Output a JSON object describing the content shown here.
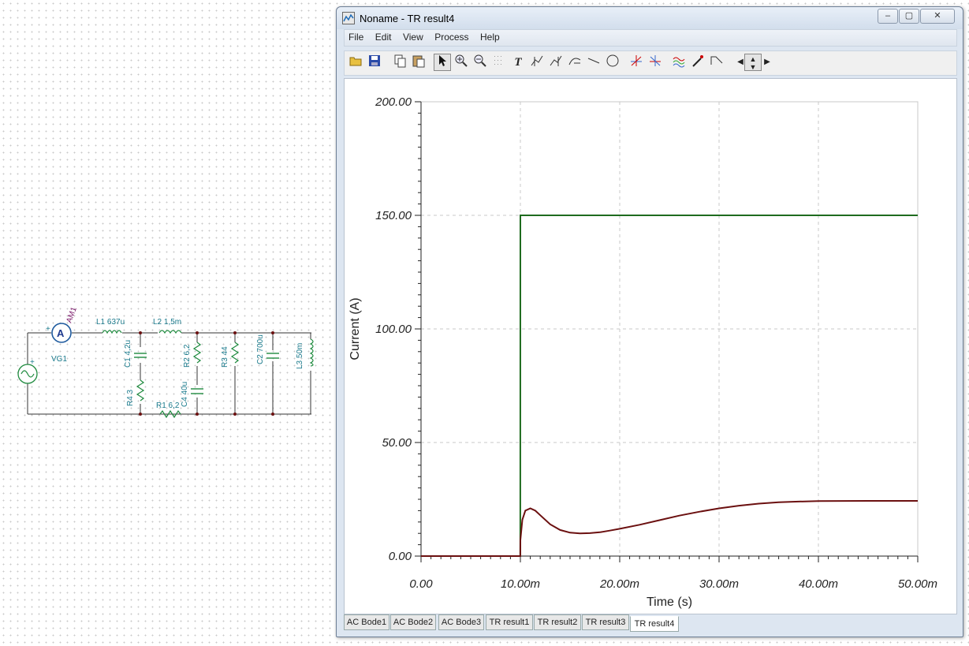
{
  "schematic": {
    "labels": {
      "am1": "AM1",
      "ammeter_symbol": "A",
      "vg1": "VG1",
      "l1": "L1 637u",
      "l2": "L2 1,5m",
      "c1": "C1 4,2u",
      "r4": "R4 3",
      "r1": "R1 6,2",
      "r2": "R2 6,2",
      "c4": "C4 40u",
      "r3": "R3 44",
      "c2": "C2 700u",
      "l3": "L3 50m",
      "plus": "+"
    }
  },
  "window": {
    "title": "Noname - TR result4",
    "controls": {
      "minimize": "–",
      "maximize": "▢",
      "close": "✕"
    }
  },
  "menu": {
    "items": [
      "File",
      "Edit",
      "View",
      "Process",
      "Help"
    ]
  },
  "toolbar": {
    "icons": [
      "open-icon",
      "save-icon",
      "copy-icon",
      "paste-icon",
      "pointer-icon",
      "zoom-in-icon",
      "zoom-fit-icon",
      "grid-icon",
      "text-icon",
      "cursor-a-icon",
      "cursor-b-icon",
      "curve-icon",
      "line-icon",
      "circle-icon",
      "marker-a-icon",
      "marker-b-icon",
      "waveform-icon",
      "probe-icon",
      "slope-icon",
      "arrow-left-icon",
      "arrow-updown-icon",
      "arrow-right-icon"
    ]
  },
  "chart_data": {
    "type": "line",
    "xlabel": "Time (s)",
    "ylabel": "Current (A)",
    "xlim": [
      0,
      0.05
    ],
    "ylim": [
      0,
      200
    ],
    "x_ticks": [
      "0.00",
      "10.00m",
      "20.00m",
      "30.00m",
      "40.00m",
      "50.00m"
    ],
    "y_ticks": [
      "0.00",
      "50.00",
      "100.00",
      "150.00",
      "200.00"
    ],
    "grid": true,
    "series": [
      {
        "color": "#1e6b1e",
        "x": [
          0,
          0.00999,
          0.01,
          0.05
        ],
        "y": [
          0,
          0,
          150,
          150
        ]
      },
      {
        "color": "#6b1010",
        "x": [
          0,
          0.00999,
          0.01,
          0.0102,
          0.0105,
          0.011,
          0.0115,
          0.012,
          0.013,
          0.014,
          0.015,
          0.016,
          0.017,
          0.018,
          0.019,
          0.02,
          0.022,
          0.024,
          0.026,
          0.028,
          0.03,
          0.032,
          0.034,
          0.036,
          0.038,
          0.04,
          0.045,
          0.05
        ],
        "y": [
          0,
          0,
          7,
          16,
          20,
          21,
          20,
          18,
          14,
          11.5,
          10.3,
          10,
          10.1,
          10.5,
          11.2,
          12,
          13.8,
          15.8,
          17.8,
          19.5,
          21,
          22.2,
          23.1,
          23.7,
          24,
          24.2,
          24.3,
          24.3
        ]
      }
    ]
  },
  "tabs": {
    "items": [
      "AC Bode1",
      "AC Bode2",
      "AC Bode3",
      "TR result1",
      "TR result2",
      "TR result3",
      "TR result4"
    ],
    "active": "TR result4"
  }
}
